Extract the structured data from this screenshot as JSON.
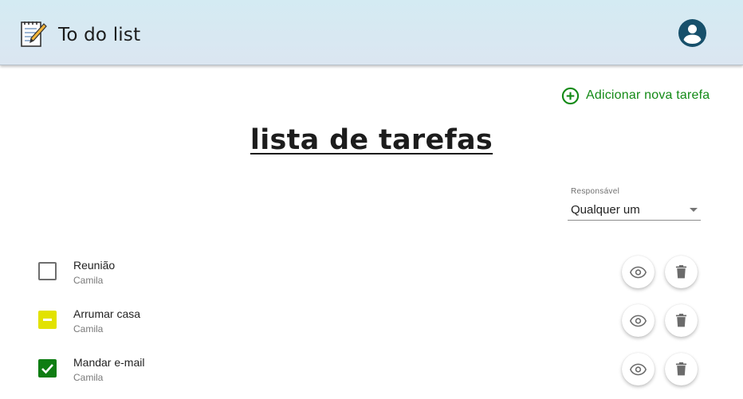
{
  "header": {
    "title": "To do list",
    "logo_icon": "notepad-pencil-icon",
    "account_icon": "account-circle-icon",
    "bg_color": "#d6e9f2",
    "account_color": "#17506b"
  },
  "actions": {
    "add_task_label": "Adicionar nova tarefa",
    "add_task_icon": "add-circle-outline-icon",
    "accent_color": "#138a16"
  },
  "main": {
    "title": "lista de tarefas"
  },
  "filter": {
    "label": "Responsável",
    "value": "Qualquer um"
  },
  "tasks": [
    {
      "title": "Reunião",
      "owner": "Camila",
      "status": "not-started",
      "status_color": "#6e6e6e"
    },
    {
      "title": "Arrumar casa",
      "owner": "Camila",
      "status": "in-progress",
      "status_color": "#e2e200"
    },
    {
      "title": "Mandar e-mail",
      "owner": "Camila",
      "status": "done",
      "status_color": "#0e7d12"
    }
  ],
  "row_actions": {
    "view_icon": "eye-icon",
    "delete_icon": "trash-icon"
  }
}
